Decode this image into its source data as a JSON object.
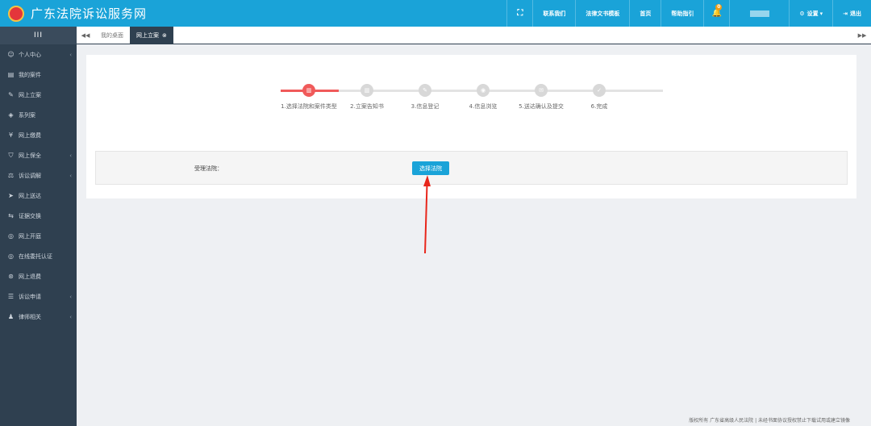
{
  "header": {
    "logo_text": "",
    "title": "广东法院诉讼服务网",
    "nav": [
      {
        "label": "联系我们"
      },
      {
        "label": "法律文书模板"
      },
      {
        "label": "首页"
      },
      {
        "label": "帮助指引"
      }
    ],
    "bell_count": "0",
    "settings_label": "设置",
    "logout_label": "退出"
  },
  "sidebar": {
    "toggle": "III",
    "items": [
      {
        "label": "个人中心",
        "icon": "user-circle-icon",
        "has_arrow": true
      },
      {
        "label": "我的案件",
        "icon": "document-icon",
        "has_arrow": false
      },
      {
        "label": "网上立案",
        "icon": "edit-icon",
        "has_arrow": false
      },
      {
        "label": "系列案",
        "icon": "layers-icon",
        "has_arrow": false
      },
      {
        "label": "网上缴费",
        "icon": "yuan-icon",
        "has_arrow": false
      },
      {
        "label": "网上保全",
        "icon": "shield-icon",
        "has_arrow": true
      },
      {
        "label": "诉讼调解",
        "icon": "handshake-icon",
        "has_arrow": true
      },
      {
        "label": "网上送达",
        "icon": "send-icon",
        "has_arrow": false
      },
      {
        "label": "证据交换",
        "icon": "exchange-icon",
        "has_arrow": false
      },
      {
        "label": "网上开庭",
        "icon": "globe-icon",
        "has_arrow": false
      },
      {
        "label": "在线委托认证",
        "icon": "globe-icon",
        "has_arrow": false
      },
      {
        "label": "网上退费",
        "icon": "refund-icon",
        "has_arrow": false
      },
      {
        "label": "诉讼申请",
        "icon": "list-icon",
        "has_arrow": true
      },
      {
        "label": "律师相关",
        "icon": "lawyer-icon",
        "has_arrow": true
      }
    ]
  },
  "tabs": {
    "items": [
      {
        "label": "我的桌面",
        "active": false
      },
      {
        "label": "网上立案",
        "active": true
      }
    ]
  },
  "steps": [
    {
      "label": "1.选择法院和案件类型",
      "active": true
    },
    {
      "label": "2.立案告知书",
      "active": false
    },
    {
      "label": "3.信息登记",
      "active": false
    },
    {
      "label": "4.信息浏览",
      "active": false
    },
    {
      "label": "5.送达确认及提交",
      "active": false
    },
    {
      "label": "6.完成",
      "active": false
    }
  ],
  "form": {
    "court_label": "受理法院：",
    "select_button": "选择法院"
  },
  "colors": {
    "primary": "#1aa3d8",
    "sidebar": "#2f4050",
    "step_active": "#f05a5a",
    "annotation_arrow": "#e8261b"
  },
  "footer": {
    "text": "版权所有 广东省高级人民法院 | 未经书面协议授权禁止下载试用或建立镜像"
  }
}
